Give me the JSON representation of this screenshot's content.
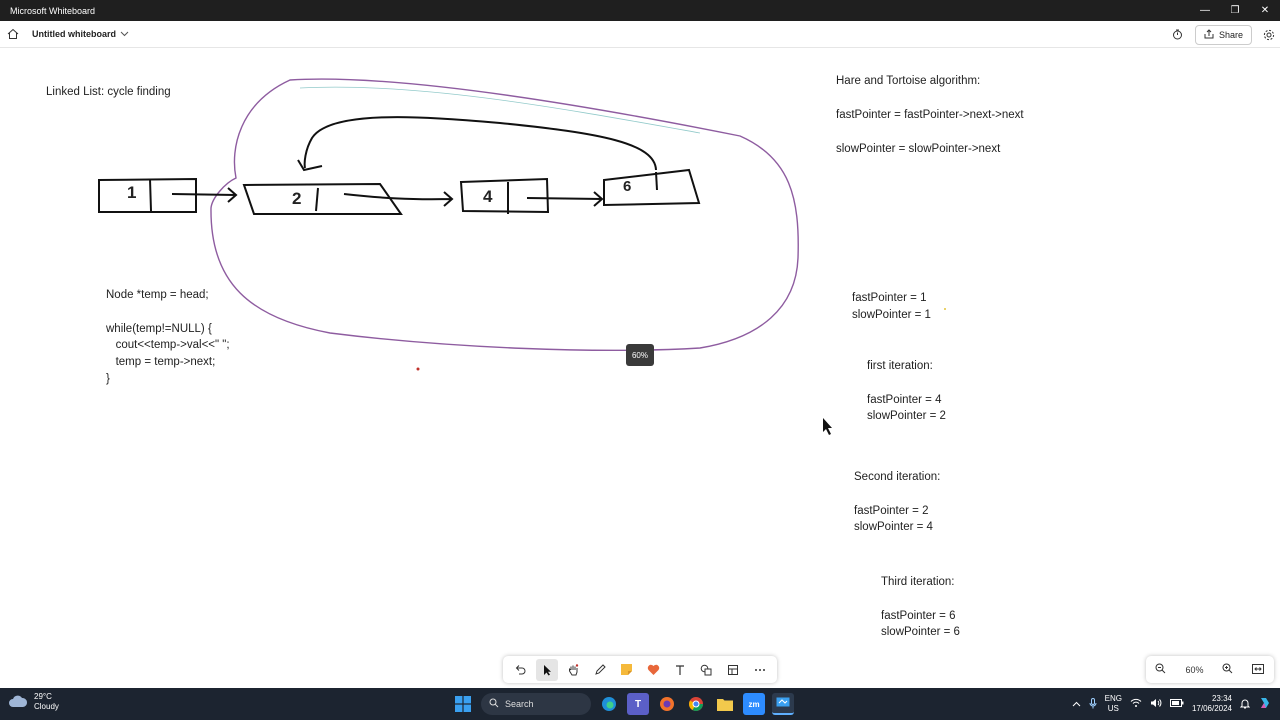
{
  "window": {
    "title": "Microsoft Whiteboard"
  },
  "header": {
    "doc_title": "Untitled whiteboard",
    "share_label": "Share"
  },
  "canvas": {
    "heading": "Linked List: cycle finding",
    "nodes": [
      "1",
      "2",
      "4",
      "6"
    ],
    "code": "Node *temp = head;\n\nwhile(temp!=NULL) {\n   cout<<temp->val<<\" \";\n   temp = temp->next;\n}",
    "algo_title": "Hare and Tortoise algorithm:",
    "fast_rule": "fastPointer = fastPointer->next->next",
    "slow_rule": "slowPointer = slowPointer->next",
    "init": "fastPointer = 1\nslowPointer = 1",
    "iter1": "first iteration:\n\nfastPointer = 4\nslowPointer = 2",
    "iter2": "Second iteration:\n\nfastPointer = 2\nslowPointer = 4",
    "iter3": "Third iteration:\n\nfastPointer = 6\nslowPointer = 6",
    "zoom_tooltip": "60%"
  },
  "zoom": {
    "level": "60%"
  },
  "taskbar": {
    "temperature": "29°C",
    "condition": "Cloudy",
    "search_label": "Search",
    "lang_top": "ENG",
    "lang_bottom": "US",
    "time": "23:34",
    "date": "17/06/2024",
    "apps": [
      "start-icon",
      "search-icon",
      "edge-icon",
      "teams-icon",
      "firefox-icon",
      "chrome-icon",
      "file-explorer-icon",
      "zoom-icon",
      "whiteboard-icon"
    ]
  },
  "colors": {
    "titlebar": "#1f1f1f",
    "taskbar": "#1c2430",
    "ink": "#111111",
    "lasso": "#7a3f8f"
  }
}
